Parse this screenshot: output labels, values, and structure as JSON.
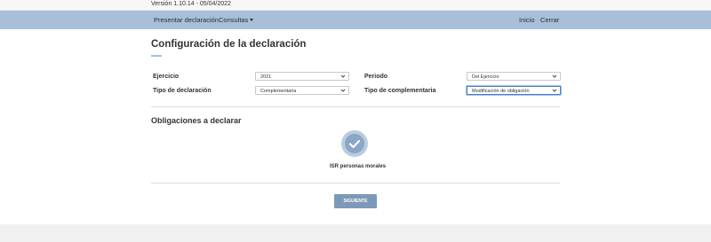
{
  "version": {
    "text": "Versión 1.10.14 - 05/04/2022"
  },
  "nav": {
    "presentar": "Presentar declaración",
    "consultas": "Consultas",
    "inicio": "Inicio",
    "cerrar": "Cerrar"
  },
  "page": {
    "title": "Configuración de la declaración"
  },
  "form": {
    "ejercicio": {
      "label": "Ejercicio",
      "value": "2021"
    },
    "periodo": {
      "label": "Periodo",
      "value": "Del Ejercicio"
    },
    "tipo_declaracion": {
      "label": "Tipo de declaración",
      "value": "Complementaria"
    },
    "tipo_complementaria": {
      "label": "Tipo de complementaria",
      "value": "Modificación de obligación"
    }
  },
  "obligaciones": {
    "title": "Obligaciones a declarar",
    "items": [
      {
        "label": "ISR personas morales",
        "icon": "check-circle-icon",
        "selected": true
      }
    ]
  },
  "actions": {
    "next_label": "SIGUIENTE"
  },
  "colors": {
    "navbar": "#a8bfd8",
    "button": "#7d99b8",
    "focus": "#4a7fc1"
  }
}
